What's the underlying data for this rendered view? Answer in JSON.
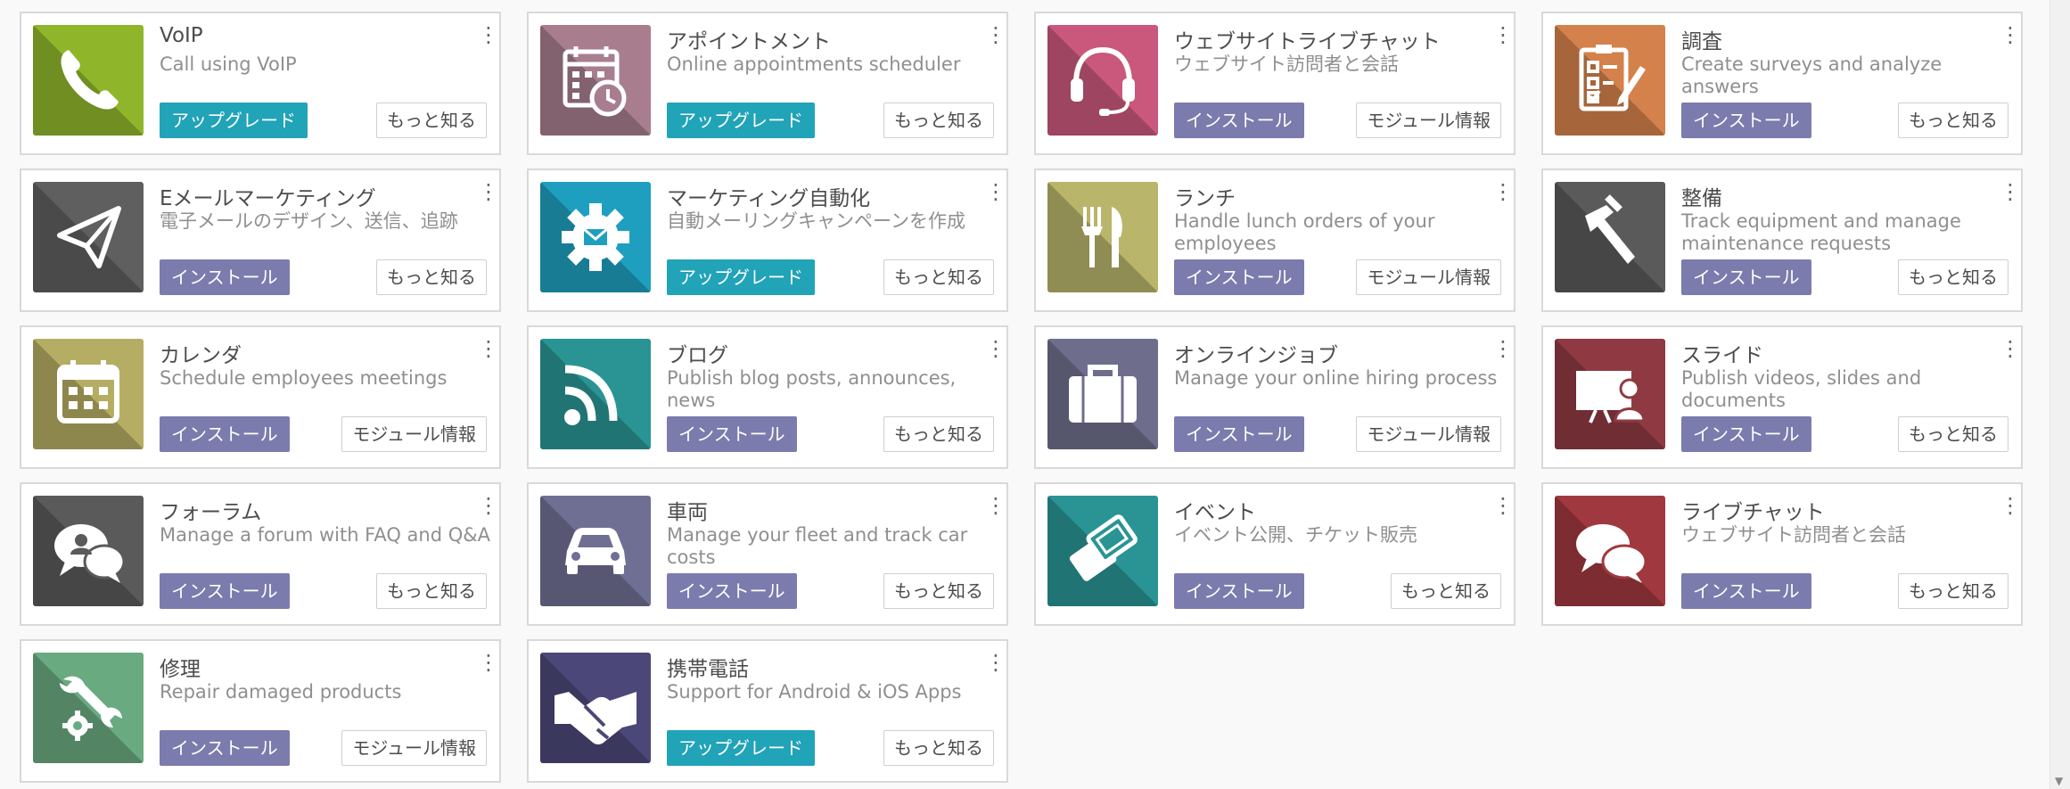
{
  "apps": [
    {
      "title": "VoIP",
      "desc": "Call using VoIP",
      "primary": "アップグレード",
      "primary_type": "upgrade",
      "secondary": "もっと知る",
      "icon": "phone-icon",
      "color": "#8fb62b"
    },
    {
      "title": "アポイントメント",
      "desc": "Online appointments scheduler",
      "primary": "アップグレード",
      "primary_type": "upgrade",
      "secondary": "もっと知る",
      "icon": "calendar-clock-icon",
      "color": "#a87e8f"
    },
    {
      "title": "ウェブサイトライブチャット",
      "desc": "ウェブサイト訪問者と会話",
      "primary": "インストール",
      "primary_type": "install",
      "secondary": "モジュール情報",
      "icon": "headset-icon",
      "color": "#c9587c"
    },
    {
      "title": "調査",
      "desc": "Create surveys and analyze answers",
      "primary": "インストール",
      "primary_type": "install",
      "secondary": "もっと知る",
      "icon": "survey-icon",
      "color": "#d4814b"
    },
    {
      "title": "Eメールマーケティング",
      "desc": "電子メールのデザイン、送信、追跡",
      "primary": "インストール",
      "primary_type": "install",
      "secondary": "もっと知る",
      "icon": "paper-plane-icon",
      "color": "#5f5f5f"
    },
    {
      "title": "マーケティング自動化",
      "desc": "自動メーリングキャンペーンを作成",
      "primary": "アップグレード",
      "primary_type": "upgrade",
      "secondary": "もっと知る",
      "icon": "gear-mail-icon",
      "color": "#1f9fbf"
    },
    {
      "title": "ランチ",
      "desc": "Handle lunch orders of your employees",
      "primary": "インストール",
      "primary_type": "install",
      "secondary": "モジュール情報",
      "icon": "fork-knife-icon",
      "color": "#b9b56b"
    },
    {
      "title": "整備",
      "desc": "Track equipment and manage maintenance requests",
      "primary": "インストール",
      "primary_type": "install",
      "secondary": "もっと知る",
      "icon": "hammer-icon",
      "color": "#5a5a5a"
    },
    {
      "title": "カレンダ",
      "desc": "Schedule employees meetings",
      "primary": "インストール",
      "primary_type": "install",
      "secondary": "モジュール情報",
      "icon": "calendar-icon",
      "color": "#b5ad63"
    },
    {
      "title": "ブログ",
      "desc": "Publish blog posts, announces, news",
      "primary": "インストール",
      "primary_type": "install",
      "secondary": "もっと知る",
      "icon": "rss-icon",
      "color": "#2a9494"
    },
    {
      "title": "オンラインジョブ",
      "desc": "Manage your online hiring process",
      "primary": "インストール",
      "primary_type": "install",
      "secondary": "モジュール情報",
      "icon": "briefcase-icon",
      "color": "#6e6e8c"
    },
    {
      "title": "スライド",
      "desc": "Publish videos, slides and documents",
      "primary": "インストール",
      "primary_type": "install",
      "secondary": "もっと知る",
      "icon": "presentation-icon",
      "color": "#8f3a42"
    },
    {
      "title": "フォーラム",
      "desc": "Manage a forum with FAQ and Q&A",
      "primary": "インストール",
      "primary_type": "install",
      "secondary": "もっと知る",
      "icon": "forum-icon",
      "color": "#5a5a5a"
    },
    {
      "title": "車両",
      "desc": "Manage your fleet and track car costs",
      "primary": "インストール",
      "primary_type": "install",
      "secondary": "もっと知る",
      "icon": "car-icon",
      "color": "#6f6f94"
    },
    {
      "title": "イベント",
      "desc": "イベント公開、チケット販売",
      "primary": "インストール",
      "primary_type": "install",
      "secondary": "もっと知る",
      "icon": "ticket-icon",
      "color": "#2a9494"
    },
    {
      "title": "ライブチャット",
      "desc": "ウェブサイト訪問者と会話",
      "primary": "インストール",
      "primary_type": "install",
      "secondary": "もっと知る",
      "icon": "chat-bubbles-icon",
      "color": "#a0393f"
    },
    {
      "title": "修理",
      "desc": "Repair damaged products",
      "primary": "インストール",
      "primary_type": "install",
      "secondary": "モジュール情報",
      "icon": "wrench-gear-icon",
      "color": "#6aaa80"
    },
    {
      "title": "携帯電話",
      "desc": "Support for Android & iOS Apps",
      "primary": "アップグレード",
      "primary_type": "upgrade",
      "secondary": "もっと知る",
      "icon": "handshake-icon",
      "color": "#4b4779"
    }
  ]
}
